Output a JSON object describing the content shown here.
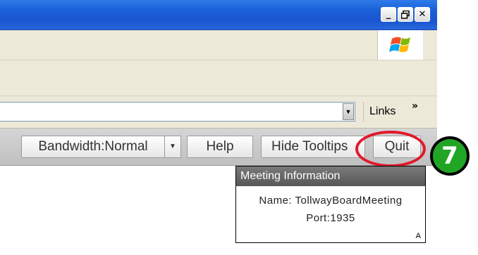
{
  "window": {
    "controls": [
      "minimize",
      "maximize",
      "close"
    ],
    "icons": [
      "minimize-icon",
      "maximize-icon",
      "close-icon"
    ],
    "brand_icon": "windows-flag-icon"
  },
  "address_bar": {
    "dropdown_icon": "chevron-down-icon",
    "links_label": "Links",
    "links_chevron": "»"
  },
  "app_toolbar": {
    "bandwidth_label": "Bandwidth:Normal",
    "help_label": "Help",
    "hide_tooltips_label": "Hide Tooltips",
    "quit_label": "Quit"
  },
  "callout": {
    "step_number": "7",
    "highlight_color": "#e01a2b",
    "badge_color": "#21a524"
  },
  "meeting_info": {
    "title": "Meeting Information",
    "name_line": "Name: TollwayBoardMeeting",
    "port_line": "Port:1935",
    "corner_letter": "A"
  }
}
